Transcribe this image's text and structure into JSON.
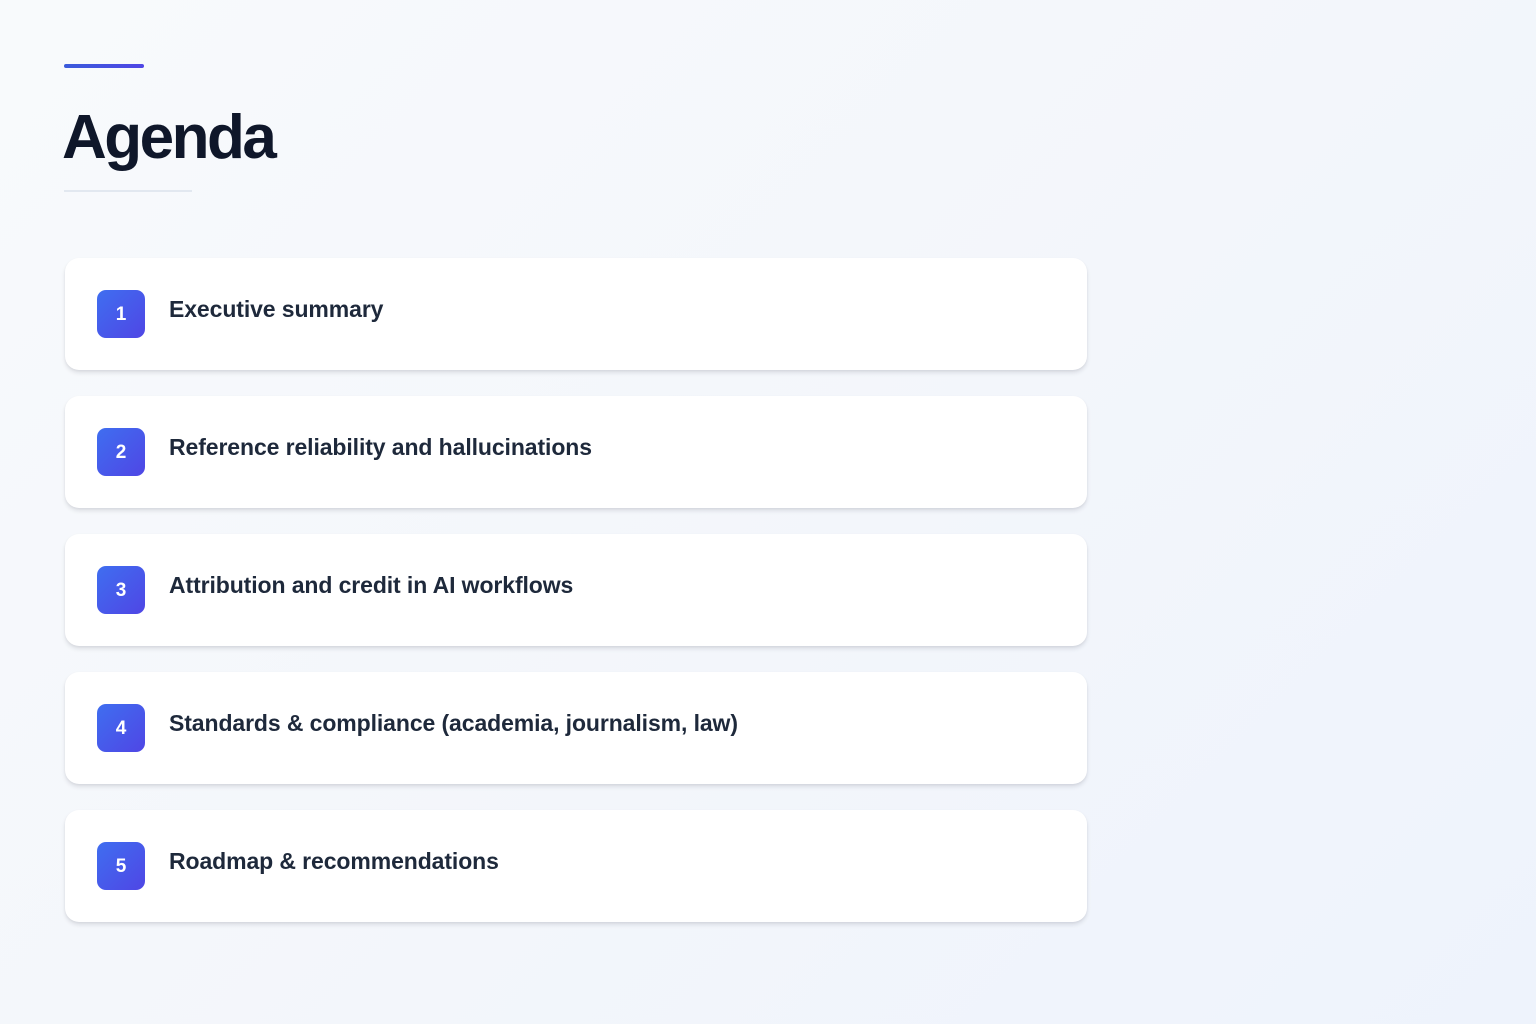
{
  "slide": {
    "title": "Agenda",
    "accent_color": "#4f46e5",
    "items": [
      {
        "number": "1",
        "label": "Executive summary"
      },
      {
        "number": "2",
        "label": "Reference reliability and hallucinations"
      },
      {
        "number": "3",
        "label": "Attribution and credit in AI workflows"
      },
      {
        "number": "4",
        "label": "Standards & compliance (academia, journalism, law)"
      },
      {
        "number": "5",
        "label": "Roadmap & recommendations"
      }
    ]
  }
}
